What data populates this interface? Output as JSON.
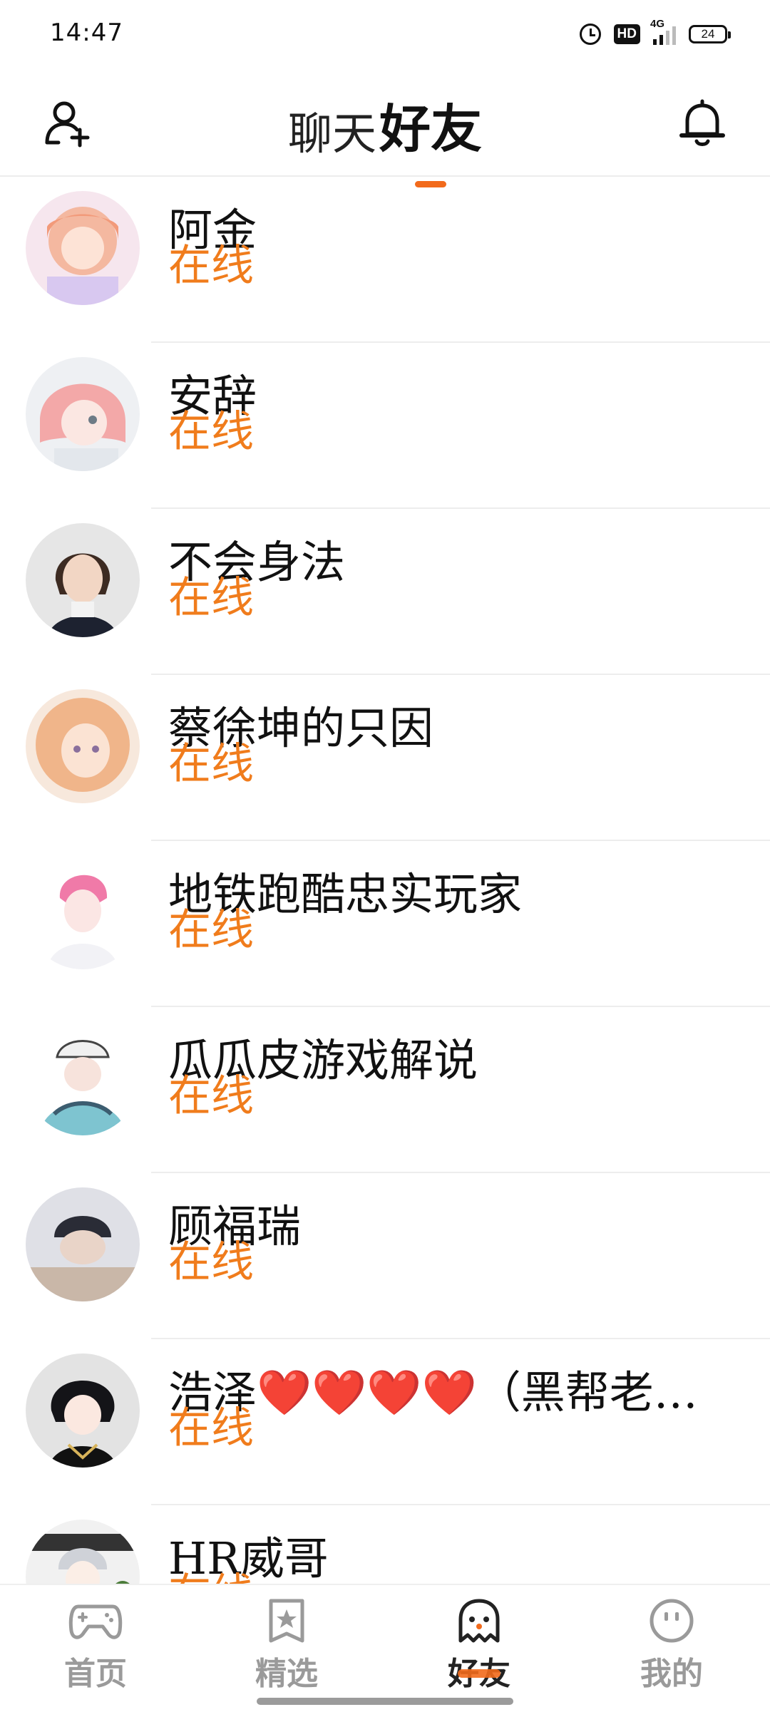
{
  "status_bar": {
    "time": "14:47",
    "hd": "HD",
    "network": "4G",
    "battery": "24"
  },
  "header": {
    "tab_chat": "聊天",
    "tab_friends": "好友",
    "active_tab": "好友",
    "accent_color": "#f26a1b",
    "left_icon": "add-friend-icon",
    "right_icon": "bell-icon"
  },
  "friends": [
    {
      "name": "阿金",
      "status": "在线"
    },
    {
      "name": "安辞",
      "status": "在线"
    },
    {
      "name": "不会身法",
      "status": "在线"
    },
    {
      "name": "蔡徐坤的只因",
      "status": "在线"
    },
    {
      "name": "地铁跑酷忠实玩家",
      "status": "在线"
    },
    {
      "name": "瓜瓜皮游戏解说",
      "status": "在线"
    },
    {
      "name": "顾福瑞",
      "status": "在线"
    },
    {
      "name": "浩泽❤️❤️❤️❤️（黑帮老…",
      "status": "在线"
    },
    {
      "name": "HR威哥",
      "status": "在线"
    }
  ],
  "online_color": "#f07c1c",
  "bottom_nav": [
    {
      "label": "首页",
      "icon": "gamepad-icon"
    },
    {
      "label": "精选",
      "icon": "star-card-icon"
    },
    {
      "label": "好友",
      "icon": "ghost-icon",
      "active": true
    },
    {
      "label": "我的",
      "icon": "smile-face-icon"
    }
  ]
}
